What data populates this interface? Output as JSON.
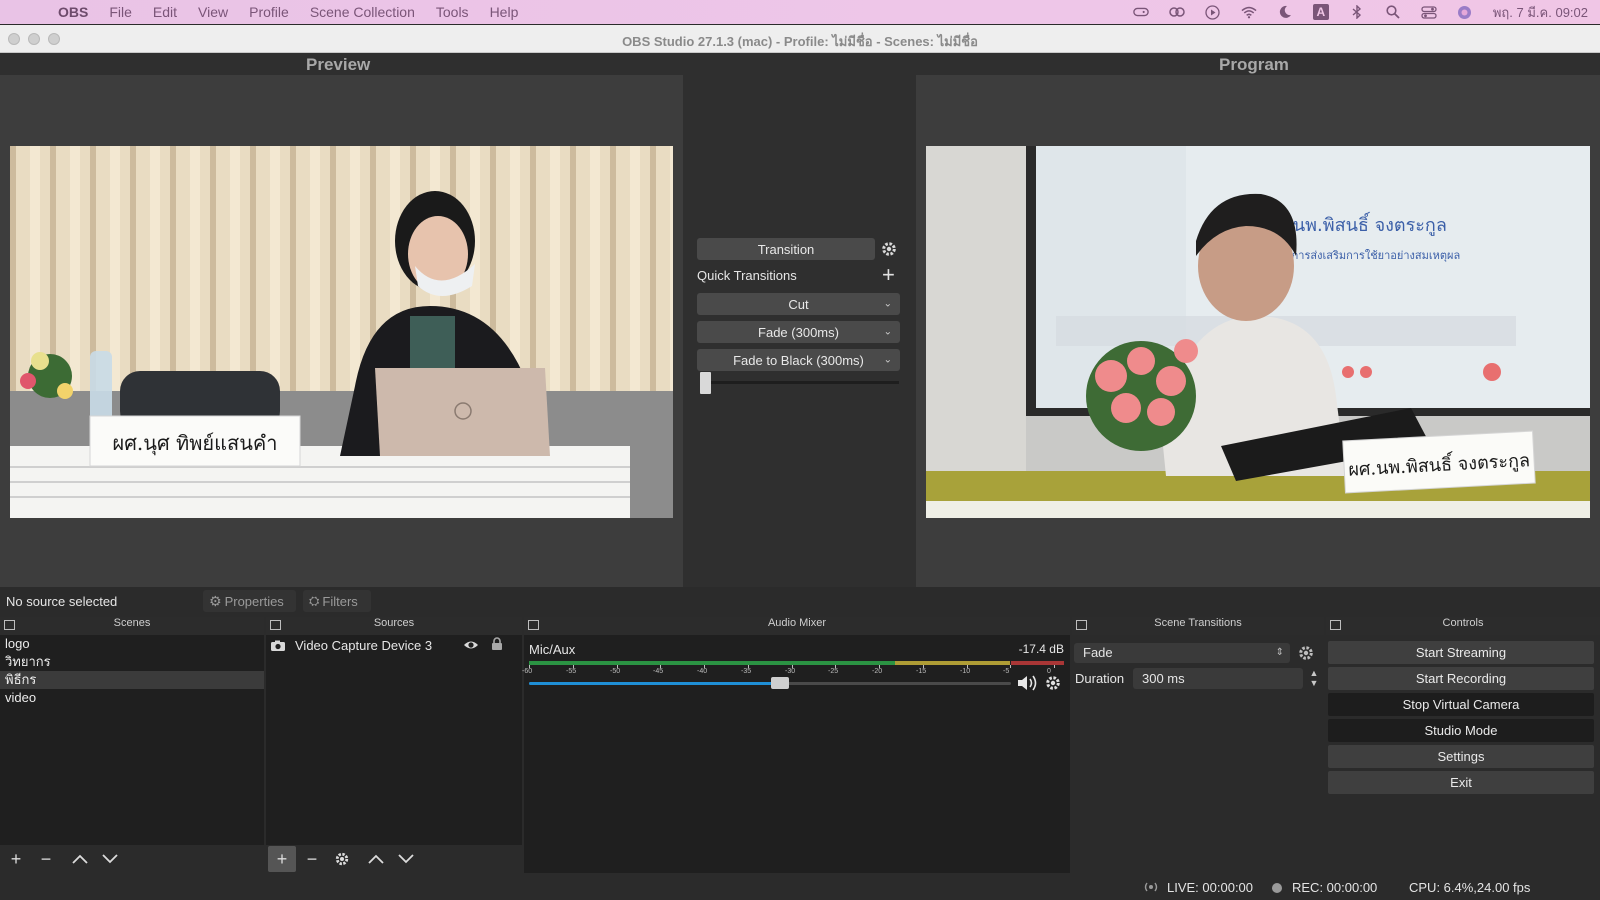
{
  "menubar": {
    "items": [
      "OBS",
      "File",
      "Edit",
      "View",
      "Profile",
      "Scene Collection",
      "Tools",
      "Help"
    ],
    "datetime": "พฤ. 7 มี.ค. 09:02",
    "input_source": "A"
  },
  "window": {
    "title": "OBS Studio 27.1.3 (mac) - Profile: ไม่มีชื่อ - Scenes: ไม่มีชื่อ"
  },
  "preview": {
    "label": "Preview",
    "nameplate": "ผศ.นุศ ทิพย์แสนคำ"
  },
  "program": {
    "label": "Program",
    "nameplate": "ผศ.นพ.พิสนธิ์ จงตระกูล",
    "screen_title": "ผศ.นพ.พิสนธิ์ จงตระกูล",
    "screen_subtitle": "อนุกรรมการส่งเสริมการใช้ยาอย่างสมเหตุผล"
  },
  "transitions_panel": {
    "transition_button": "Transition",
    "quick_transitions": "Quick Transitions",
    "items": [
      "Cut",
      "Fade (300ms)",
      "Fade to Black (300ms)"
    ]
  },
  "status": {
    "no_source": "No source selected",
    "properties": "Properties",
    "filters": "Filters"
  },
  "scenes": {
    "header": "Scenes",
    "items": [
      "logo",
      "วิทยากร",
      "พิธีกร",
      "video"
    ],
    "selected": "พิธีกร"
  },
  "sources": {
    "header": "Sources",
    "items": [
      "Video Capture Device 3"
    ]
  },
  "audio_mixer": {
    "header": "Audio Mixer",
    "channel": "Mic/Aux",
    "level": "-17.4 dB",
    "scale": [
      "-60",
      "-55",
      "-50",
      "-45",
      "-40",
      "-35",
      "-30",
      "-25",
      "-20",
      "-15",
      "-10",
      "-5",
      "0"
    ],
    "volume_fraction": 0.52
  },
  "scene_transitions": {
    "header": "Scene Transitions",
    "selected": "Fade",
    "duration_label": "Duration",
    "duration_value": "300 ms"
  },
  "controls": {
    "header": "Controls",
    "buttons": [
      "Start Streaming",
      "Start Recording",
      "Stop Virtual Camera",
      "Studio Mode",
      "Settings",
      "Exit"
    ]
  },
  "statusbar": {
    "live": "LIVE: 00:00:00",
    "rec": "REC: 00:00:00",
    "cpu": "CPU: 6.4%,24.00 fps"
  },
  "colors": {
    "menubar_bg": "#ecc4e7",
    "panel_bg": "#1f1f1f",
    "button_bg": "#3f3f3f",
    "meter_green": "#2ea84a",
    "meter_yellow": "#c8b33a",
    "meter_red": "#c23b3b",
    "slider_blue": "#1f8fd6"
  }
}
